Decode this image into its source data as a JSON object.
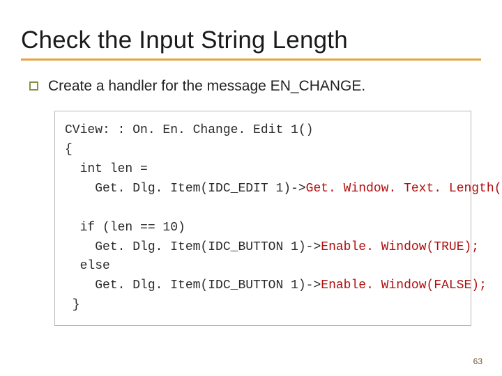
{
  "title": "Check the Input String Length",
  "bullet": "Create a handler for the message EN_CHANGE.",
  "code": {
    "l1": "CView: : On. En. Change. Edit 1()",
    "l2": "{",
    "l3": "  int len =",
    "l4a": "    Get. Dlg. Item(IDC_EDIT 1)->",
    "l4b": "Get. Window. Text. Length();",
    "l5": "",
    "l6": "  if (len == 10)",
    "l7a": "    Get. Dlg. Item(IDC_BUTTON 1)->",
    "l7b": "Enable. Window(TRUE);",
    "l8": "  else",
    "l9a": "    Get. Dlg. Item(IDC_BUTTON 1)->",
    "l9b": "Enable. Window(FALSE);",
    "l10": " }"
  },
  "page_number": "63"
}
